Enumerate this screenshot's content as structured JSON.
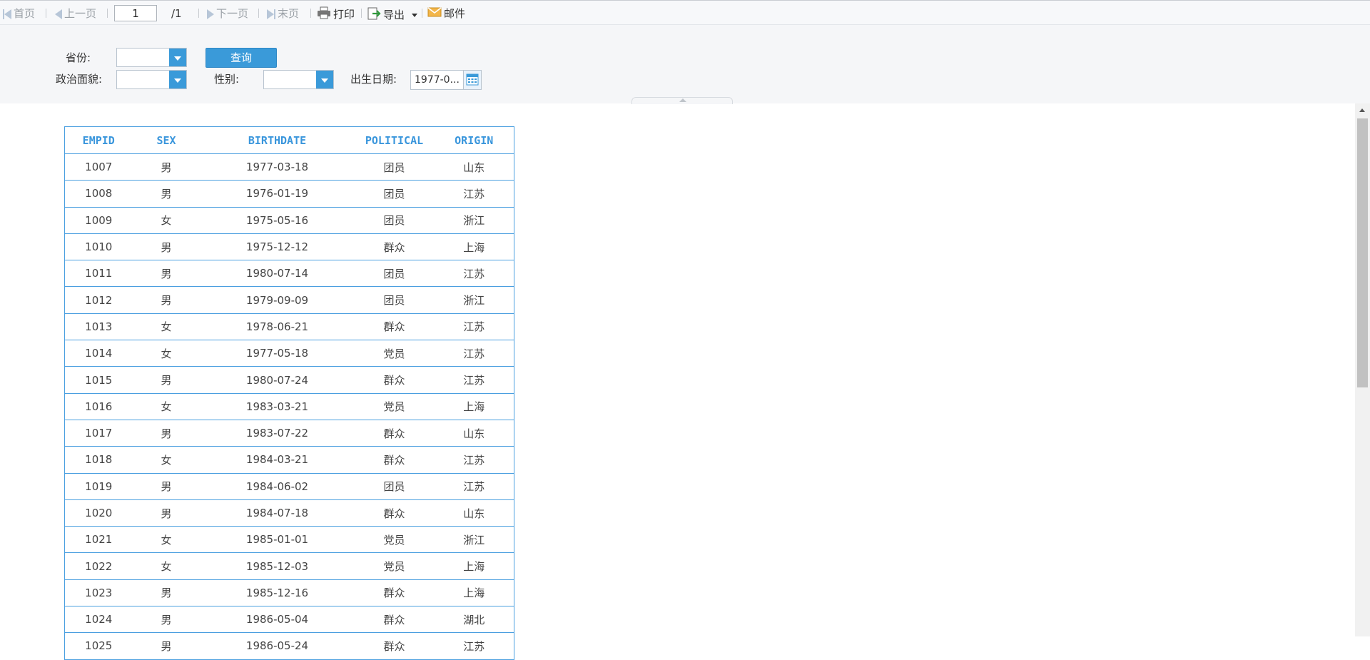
{
  "toolbar": {
    "first_label": "首页",
    "prev_label": "上一页",
    "page_value": "1",
    "page_total": "/1",
    "next_label": "下一页",
    "last_label": "末页",
    "print_label": "打印",
    "export_label": "导出",
    "mail_label": "邮件"
  },
  "params": {
    "province_label": "省份:",
    "province_value": "",
    "query_label": "查询",
    "political_label": "政治面貌:",
    "political_value": "",
    "sex_label": "性别:",
    "sex_value": "",
    "birthdate_label": "出生日期:",
    "birthdate_value": "1977-0..."
  },
  "table": {
    "headers": [
      "EMPID",
      "SEX",
      "BIRTHDATE",
      "POLITICAL",
      "ORIGIN"
    ],
    "rows": [
      [
        "1007",
        "男",
        "1977-03-18",
        "团员",
        "山东"
      ],
      [
        "1008",
        "男",
        "1976-01-19",
        "团员",
        "江苏"
      ],
      [
        "1009",
        "女",
        "1975-05-16",
        "团员",
        "浙江"
      ],
      [
        "1010",
        "男",
        "1975-12-12",
        "群众",
        "上海"
      ],
      [
        "1011",
        "男",
        "1980-07-14",
        "团员",
        "江苏"
      ],
      [
        "1012",
        "男",
        "1979-09-09",
        "团员",
        "浙江"
      ],
      [
        "1013",
        "女",
        "1978-06-21",
        "群众",
        "江苏"
      ],
      [
        "1014",
        "女",
        "1977-05-18",
        "党员",
        "江苏"
      ],
      [
        "1015",
        "男",
        "1980-07-24",
        "群众",
        "江苏"
      ],
      [
        "1016",
        "女",
        "1983-03-21",
        "党员",
        "上海"
      ],
      [
        "1017",
        "男",
        "1983-07-22",
        "群众",
        "山东"
      ],
      [
        "1018",
        "女",
        "1984-03-21",
        "群众",
        "江苏"
      ],
      [
        "1019",
        "男",
        "1984-06-02",
        "团员",
        "江苏"
      ],
      [
        "1020",
        "男",
        "1984-07-18",
        "群众",
        "山东"
      ],
      [
        "1021",
        "女",
        "1985-01-01",
        "党员",
        "浙江"
      ],
      [
        "1022",
        "女",
        "1985-12-03",
        "党员",
        "上海"
      ],
      [
        "1023",
        "男",
        "1985-12-16",
        "群众",
        "上海"
      ],
      [
        "1024",
        "男",
        "1986-05-04",
        "群众",
        "湖北"
      ],
      [
        "1025",
        "男",
        "1986-05-24",
        "群众",
        "江苏"
      ]
    ]
  },
  "colors": {
    "accent": "#3a9ad9",
    "header_text": "#3a96dc",
    "grid_line": "#4a9fe0",
    "toolbar_bg": "#f7f8fa",
    "panel_bg": "#f5f6f8"
  },
  "icons": [
    "first-page-icon",
    "prev-page-icon",
    "next-page-icon",
    "last-page-icon",
    "print-icon",
    "export-icon",
    "mail-icon",
    "calendar-icon",
    "dropdown-arrow-icon"
  ]
}
